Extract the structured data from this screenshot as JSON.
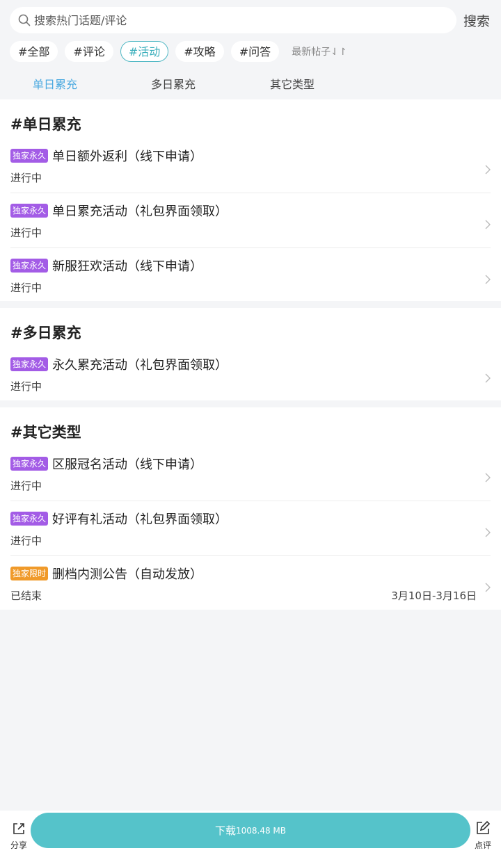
{
  "search": {
    "placeholder": "搜索热门话题/评论",
    "button_label": "搜索",
    "icon": "search-icon"
  },
  "filter_chips": [
    {
      "label": "#全部",
      "active": false
    },
    {
      "label": "#评论",
      "active": false
    },
    {
      "label": "#活动",
      "active": true
    },
    {
      "label": "#攻略",
      "active": false
    },
    {
      "label": "#问答",
      "active": false
    }
  ],
  "sort": {
    "label": "最新帖子⇃↾"
  },
  "subtabs": [
    {
      "label": "单日累充",
      "active": true
    },
    {
      "label": "多日累充",
      "active": false
    },
    {
      "label": "其它类型",
      "active": false
    }
  ],
  "sections": [
    {
      "title": "#单日累充",
      "items": [
        {
          "badge": "独家永久",
          "title": "单日额外返利（线下申请）",
          "status": "进行中"
        },
        {
          "badge": "独家永久",
          "title": "单日累充活动（礼包界面领取）",
          "status": "进行中"
        },
        {
          "badge": "独家永久",
          "title": "新服狂欢活动（线下申请）",
          "status": "进行中"
        }
      ]
    },
    {
      "title": "#多日累充",
      "items": [
        {
          "badge": "独家永久",
          "title": "永久累充活动（礼包界面领取）",
          "status": "进行中"
        }
      ]
    },
    {
      "title": "#其它类型",
      "items": [
        {
          "badge": "独家永久",
          "title": "区服冠名活动（线下申请）",
          "status": "进行中"
        },
        {
          "badge": "独家永久",
          "title": "好评有礼活动（礼包界面领取）",
          "status": "进行中"
        },
        {
          "badge": "独家限时",
          "title": "删档内测公告（自动发放）",
          "status": "已结束",
          "date": "3月10日-3月16日"
        }
      ]
    }
  ],
  "bottom_bar": {
    "share_label": "分享",
    "download_label": "下载",
    "download_size": "1008.48 MB",
    "review_label": "点评"
  },
  "colors": {
    "accent": "#55c3ca",
    "active_chip": "#3aaebb",
    "active_tab": "#4aa9e0",
    "badge_permanent": "#a35ce6",
    "badge_limited": "#f09a2a"
  }
}
